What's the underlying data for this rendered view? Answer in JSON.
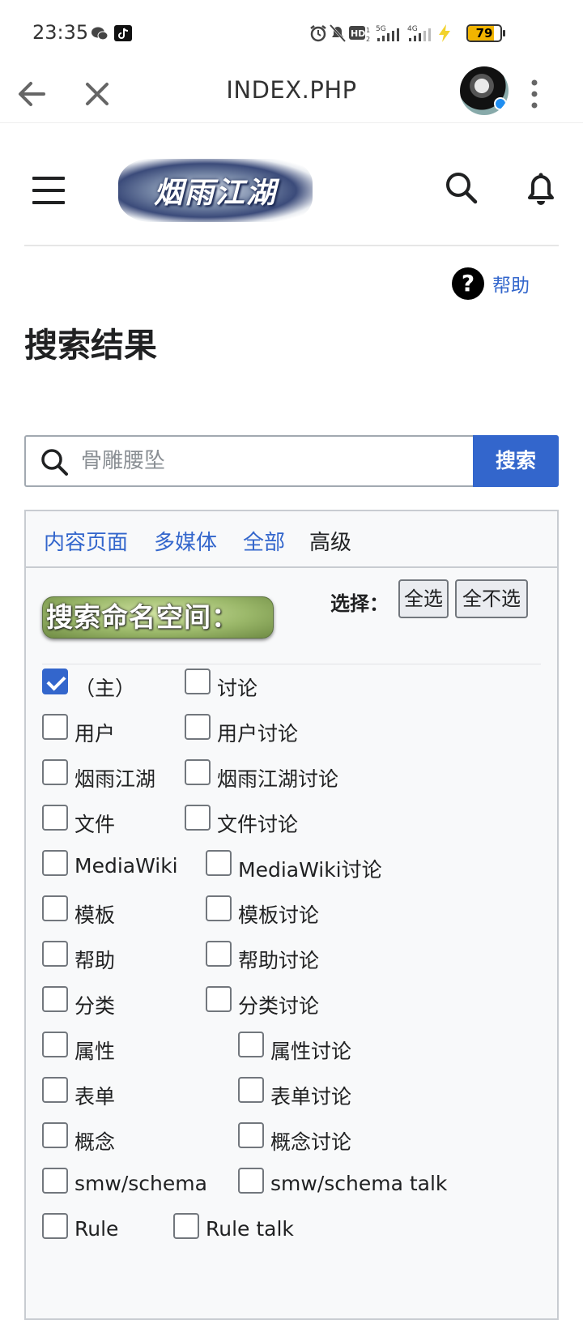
{
  "status_bar": {
    "time": "23:35",
    "battery": "79",
    "battery_level": 0.79
  },
  "browser": {
    "title": "INDEX.PHP"
  },
  "site": {
    "logo_text": "烟雨江湖"
  },
  "help": {
    "icon": "?",
    "label": "帮助"
  },
  "page_title": "搜索结果",
  "search": {
    "placeholder": "骨雕腰坠",
    "button": "搜索"
  },
  "tabs": [
    {
      "label": "内容页面",
      "active": false
    },
    {
      "label": "多媒体",
      "active": false
    },
    {
      "label": "全部",
      "active": false
    },
    {
      "label": "高级",
      "active": true
    }
  ],
  "namespace_heading": "搜索命名空间：",
  "select": {
    "label": "选择：",
    "all": "全选",
    "none": "全不选"
  },
  "namespaces": [
    [
      {
        "label": "（主）",
        "checked": true
      },
      {
        "label": "讨论",
        "checked": false
      }
    ],
    [
      {
        "label": "用户",
        "checked": false
      },
      {
        "label": "用户讨论",
        "checked": false
      }
    ],
    [
      {
        "label": "烟雨江湖",
        "checked": false
      },
      {
        "label": "烟雨江湖讨论",
        "checked": false
      }
    ],
    [
      {
        "label": "文件",
        "checked": false
      },
      {
        "label": "文件讨论",
        "checked": false
      }
    ],
    [
      {
        "label": "MediaWiki",
        "checked": false
      },
      {
        "label": "MediaWiki讨论",
        "checked": false
      }
    ],
    [
      {
        "label": "模板",
        "checked": false
      },
      {
        "label": "模板讨论",
        "checked": false
      }
    ],
    [
      {
        "label": "帮助",
        "checked": false
      },
      {
        "label": "帮助讨论",
        "checked": false
      }
    ],
    [
      {
        "label": "分类",
        "checked": false
      },
      {
        "label": "分类讨论",
        "checked": false
      }
    ],
    [
      {
        "label": "属性",
        "checked": false
      },
      {
        "label": "属性讨论",
        "checked": false
      }
    ],
    [
      {
        "label": "表单",
        "checked": false
      },
      {
        "label": "表单讨论",
        "checked": false
      }
    ],
    [
      {
        "label": "概念",
        "checked": false
      },
      {
        "label": "概念讨论",
        "checked": false
      }
    ],
    [
      {
        "label": "smw/schema",
        "checked": false
      },
      {
        "label": "smw/schema talk",
        "checked": false
      }
    ],
    [
      {
        "label": "Rule",
        "checked": false
      },
      {
        "label": "Rule talk",
        "checked": false
      }
    ]
  ],
  "colors": {
    "link": "#3366cc",
    "primary_button": "#3366cc",
    "text": "#202122"
  }
}
